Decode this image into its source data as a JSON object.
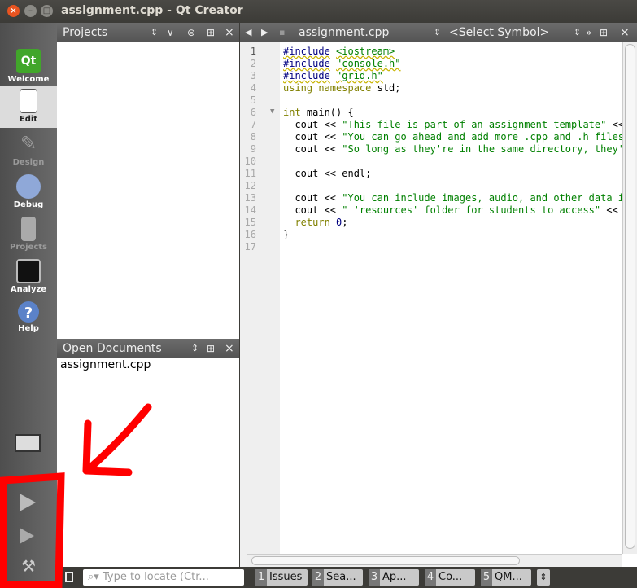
{
  "window": {
    "title": "assignment.cpp - Qt Creator"
  },
  "modes": [
    {
      "label": "Welcome"
    },
    {
      "label": "Edit"
    },
    {
      "label": "Design"
    },
    {
      "label": "Debug"
    },
    {
      "label": "Projects"
    },
    {
      "label": "Analyze"
    },
    {
      "label": "Help"
    }
  ],
  "projects_panel": {
    "title": "Projects"
  },
  "open_documents": {
    "title": "Open Documents",
    "items": [
      "assignment.cpp"
    ]
  },
  "editor": {
    "file_label": "assignment.cpp",
    "symbol_label": "<Select Symbol>",
    "line_numbers": [
      "1",
      "2",
      "3",
      "4",
      "5",
      "6",
      "7",
      "8",
      "9",
      "10",
      "11",
      "12",
      "13",
      "14",
      "15",
      "16",
      "17"
    ],
    "lines": [
      [
        [
          "pp",
          "#include"
        ],
        [
          "p",
          " "
        ],
        [
          "ppstr",
          "<iostream>"
        ]
      ],
      [
        [
          "pp",
          "#include"
        ],
        [
          "p",
          " "
        ],
        [
          "ppstr",
          "\"console.h\""
        ]
      ],
      [
        [
          "pp",
          "#include"
        ],
        [
          "p",
          " "
        ],
        [
          "ppstr",
          "\"grid.h\""
        ]
      ],
      [
        [
          "kw",
          "using namespace"
        ],
        [
          "p",
          " std;"
        ]
      ],
      [],
      [
        [
          "kw",
          "int"
        ],
        [
          "p",
          " main() {"
        ]
      ],
      [
        [
          "p",
          "  cout << "
        ],
        [
          "str",
          "\"This file is part of an assignment template\""
        ],
        [
          "p",
          " <<"
        ]
      ],
      [
        [
          "p",
          "  cout << "
        ],
        [
          "str",
          "\"You can go ahead and add more .cpp and .h files"
        ]
      ],
      [
        [
          "p",
          "  cout << "
        ],
        [
          "str",
          "\"So long as they're in the same directory, they'"
        ]
      ],
      [],
      [
        [
          "p",
          "  cout << endl;"
        ]
      ],
      [],
      [
        [
          "p",
          "  cout << "
        ],
        [
          "str",
          "\"You can include images, audio, and other data i"
        ]
      ],
      [
        [
          "p",
          "  cout << "
        ],
        [
          "str",
          "\" 'resources' folder for students to access\""
        ],
        [
          "p",
          " <<"
        ]
      ],
      [
        [
          "kw",
          "  return"
        ],
        [
          "p",
          " "
        ],
        [
          "num",
          "0"
        ],
        [
          "p",
          ";"
        ]
      ],
      [
        [
          "p",
          "}"
        ]
      ],
      []
    ]
  },
  "bottom": {
    "locator_placeholder": "Type to locate (Ctr...",
    "tabs": [
      {
        "num": "1",
        "label": "Issues"
      },
      {
        "num": "2",
        "label": "Sea..."
      },
      {
        "num": "3",
        "label": "Ap..."
      },
      {
        "num": "4",
        "label": "Co..."
      },
      {
        "num": "5",
        "label": "QM..."
      }
    ]
  },
  "colors": {
    "annotation": "#ff0000"
  }
}
